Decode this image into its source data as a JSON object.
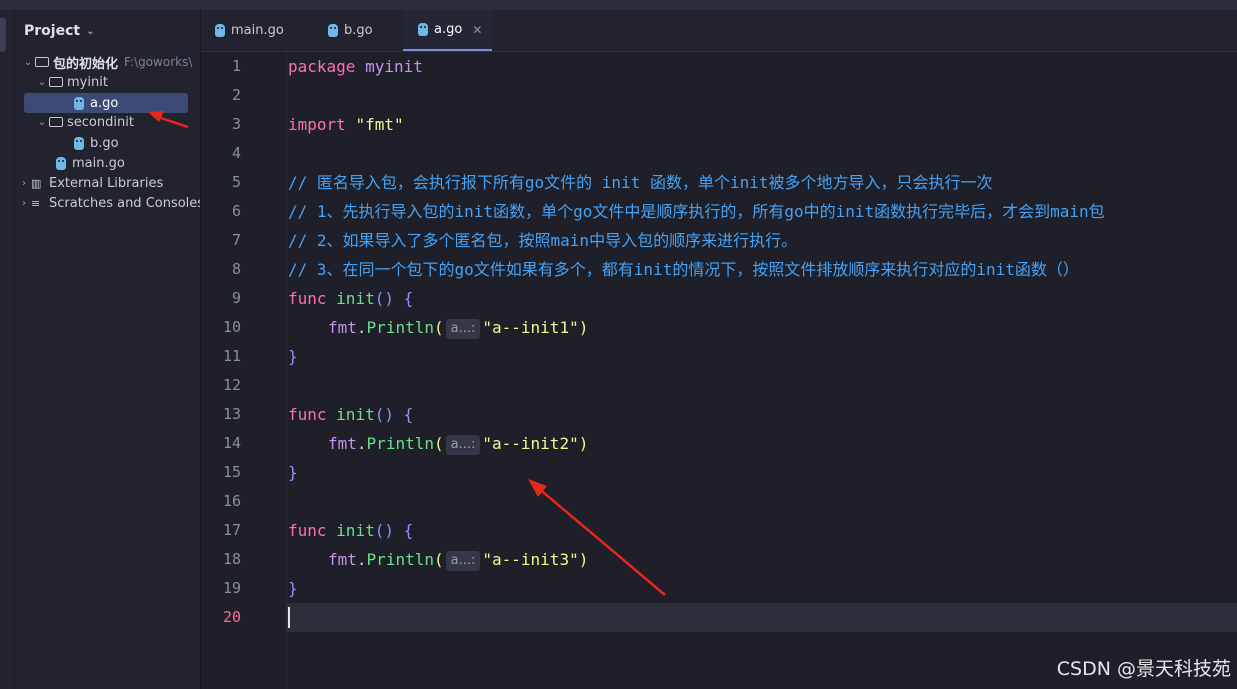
{
  "sidebar": {
    "title": "Project",
    "tree": [
      {
        "label": "包的初始化",
        "extra": "F:\\goworks\\"
      },
      {
        "label": "myinit"
      },
      {
        "label": "a.go"
      },
      {
        "label": "secondinit"
      },
      {
        "label": "b.go"
      },
      {
        "label": "main.go"
      },
      {
        "label": "External Libraries"
      },
      {
        "label": "Scratches and Consoles"
      }
    ]
  },
  "tabs": [
    {
      "label": "main.go"
    },
    {
      "label": "b.go"
    },
    {
      "label": "a.go",
      "active": true
    }
  ],
  "editor": {
    "current_line": 20,
    "line_numbers": [
      "1",
      "2",
      "3",
      "4",
      "5",
      "6",
      "7",
      "8",
      "9",
      "10",
      "11",
      "12",
      "13",
      "14",
      "15",
      "16",
      "17",
      "18",
      "19",
      "20"
    ],
    "inlay_hint": "a...:",
    "code": {
      "l1_kw": "package",
      "l1_name": "myinit",
      "l3_kw": "import",
      "l3_str": "\"fmt\"",
      "c5": "// 匿名导入包，会执行报下所有go文件的 init 函数，单个init被多个地方导入，只会执行一次",
      "c6": "// 1、先执行导入包的init函数，单个go文件中是顺序执行的，所有go中的init函数执行完毕后，才会到main包",
      "c7": "// 2、如果导入了多个匿名包，按照main中导入包的顺序来进行执行。",
      "c8": "// 3、在同一个包下的go文件如果有多个，都有init的情况下，按照文件排放顺序来执行对应的init函数（）",
      "func_kw": "func",
      "func_name": "init",
      "paren_open": "() {",
      "pkg": "fmt",
      "call": "Println",
      "close_brace": "}",
      "s1": "\"a--init1\"",
      "s2": "\"a--init2\"",
      "s3": "\"a--init3\""
    }
  },
  "watermark": "CSDN @景天科技苑",
  "colors": {
    "background": "#1e1f29",
    "keyword": "#ff6fb5",
    "string": "#f1fa8c",
    "comment": "#46a2f5",
    "function": "#69e08c",
    "annotation_arrow": "#e8261c"
  }
}
